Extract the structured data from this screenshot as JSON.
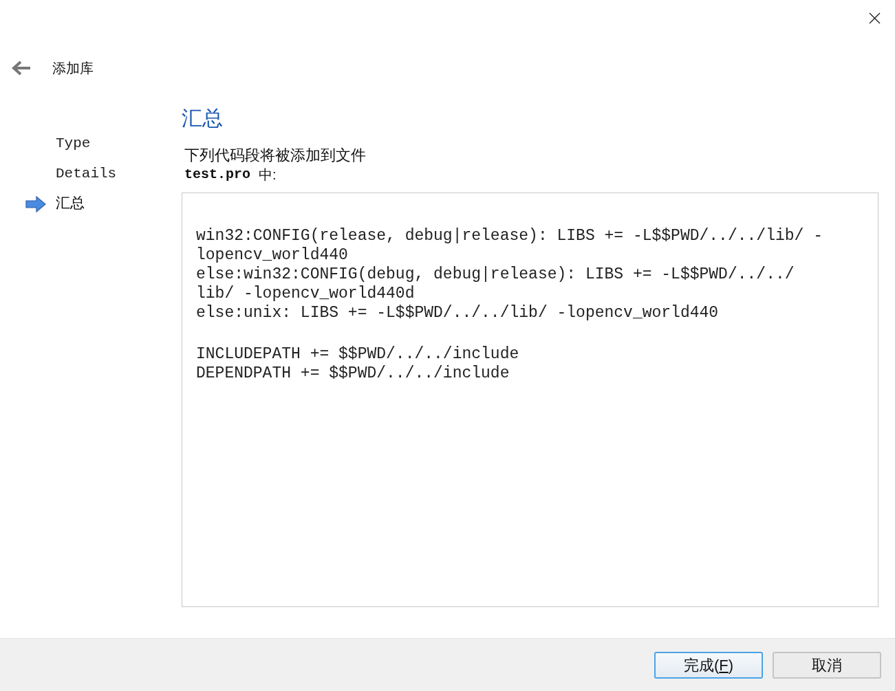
{
  "window": {
    "title": "添加库"
  },
  "steps": [
    {
      "label": "Type",
      "selected": false
    },
    {
      "label": "Details",
      "selected": false
    },
    {
      "label": "汇总",
      "selected": true
    }
  ],
  "page": {
    "heading": "汇总",
    "intro": "下列代码段将被添加到文件",
    "file": "test.pro",
    "file_suffix": "中:",
    "code_blocks": [
      [
        "win32:CONFIG(release, debug|release): LIBS += -L$$PWD/../../lib/ -",
        "lopencv_world440",
        "else:win32:CONFIG(debug, debug|release): LIBS += -L$$PWD/../../",
        "lib/ -lopencv_world440d",
        "else:unix: LIBS += -L$$PWD/../../lib/ -lopencv_world440"
      ],
      [
        "INCLUDEPATH += $$PWD/../../include",
        "DEPENDPATH += $$PWD/../../include"
      ]
    ]
  },
  "buttons": [
    {
      "label": "完成(",
      "access_key": "F",
      "label_end": ")",
      "default": true
    },
    {
      "label": "取消",
      "default": false
    }
  ]
}
